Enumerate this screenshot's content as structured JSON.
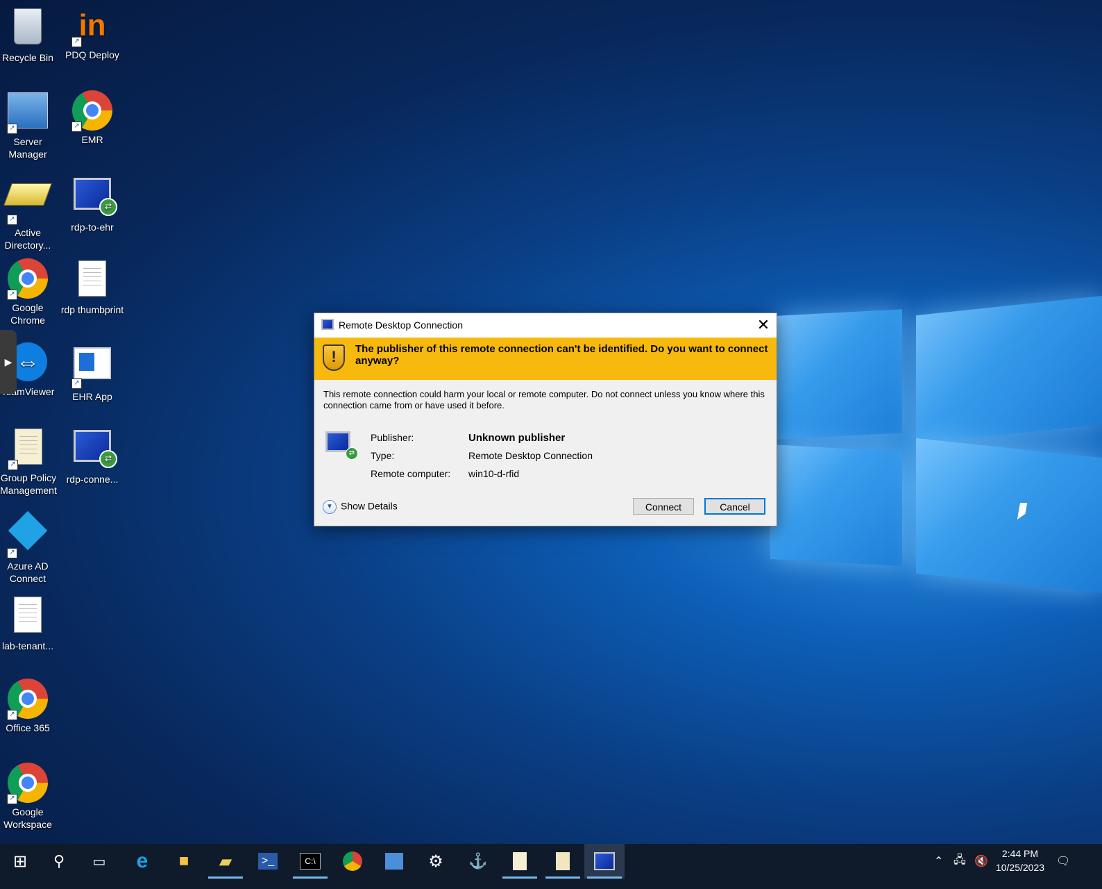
{
  "desktop": {
    "icons": [
      {
        "label": "Recycle Bin",
        "icon": "recycle-bin-icon"
      },
      {
        "label": "PDQ Deploy",
        "icon": "pdq-deploy-icon"
      },
      {
        "label": "Server Manager",
        "icon": "server-manager-icon"
      },
      {
        "label": "EMR",
        "icon": "chrome-icon"
      },
      {
        "label": "Active Directory...",
        "icon": "active-directory-icon"
      },
      {
        "label": "rdp-to-ehr",
        "icon": "remote-desktop-icon"
      },
      {
        "label": "Google Chrome",
        "icon": "chrome-icon"
      },
      {
        "label": "rdp thumbprint",
        "icon": "text-document-icon"
      },
      {
        "label": "TeamViewer",
        "icon": "teamviewer-icon"
      },
      {
        "label": "EHR App",
        "icon": "ehr-app-icon"
      },
      {
        "label": "Group Policy Management",
        "icon": "group-policy-icon"
      },
      {
        "label": "rdp-conne...",
        "icon": "remote-desktop-icon"
      },
      {
        "label": "Azure AD Connect",
        "icon": "azure-ad-connect-icon"
      },
      {
        "label": "lab-tenant...",
        "icon": "text-document-icon"
      },
      {
        "label": "Office 365",
        "icon": "chrome-icon"
      },
      {
        "label": "Google Workspace",
        "icon": "chrome-icon"
      }
    ]
  },
  "dialog": {
    "title": "Remote Desktop Connection",
    "warning": "The publisher of this remote connection can't be identified. Do you want to connect anyway?",
    "description": "This remote connection could harm your local or remote computer. Do not connect unless you know where this connection came from or have used it before.",
    "publisher_label": "Publisher:",
    "publisher_value": "Unknown publisher",
    "type_label": "Type:",
    "type_value": "Remote Desktop Connection",
    "remote_label": "Remote computer:",
    "remote_value": "win10-d-rfid",
    "show_details": "Show Details",
    "connect_label": "Connect",
    "cancel_label": "Cancel"
  },
  "taskbar": {
    "items": [
      "start",
      "search",
      "task-view",
      "internet-explorer",
      "file-explorer",
      "active-directory",
      "powershell",
      "command-prompt",
      "chrome",
      "server-manager",
      "settings",
      "network-tool",
      "notepad",
      "group-policy",
      "remote-desktop"
    ],
    "time": "2:44 PM",
    "date": "10/25/2023"
  }
}
